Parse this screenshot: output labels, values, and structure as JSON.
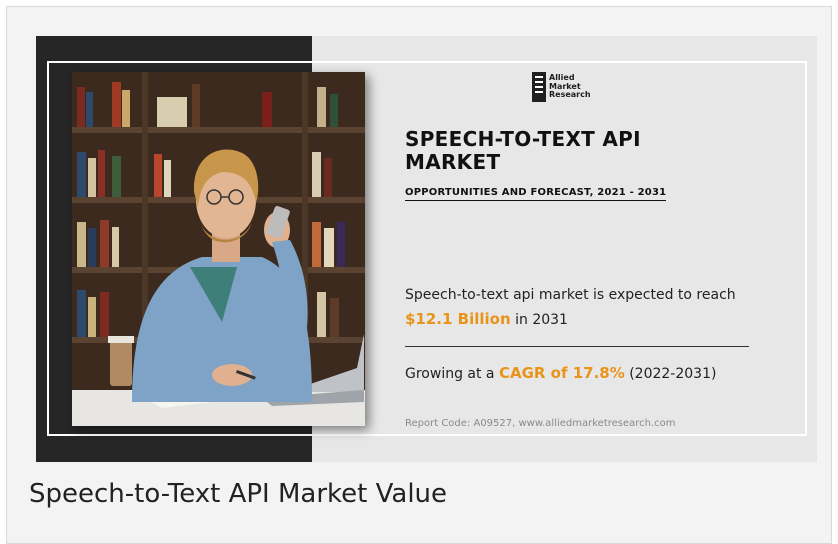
{
  "banner": {
    "logo_lines": [
      "Allied",
      "Market",
      "Research"
    ],
    "title_line1": "SPEECH-TO-TEXT API",
    "title_line2": "MARKET",
    "subtitle": "OPPORTUNITIES AND FORECAST, 2021 - 2031",
    "expect_text": "Speech-to-text api market is expected to reach",
    "expect_value": "$12.1 Billion",
    "expect_suffix": "in 2031",
    "growth_prefix": "Growing at a",
    "growth_value": "CAGR of 17.8%",
    "growth_suffix": "(2022-2031)",
    "report_code": "Report Code: A09527, www.alliedmarketresearch.com"
  },
  "caption": "Speech-to-Text API Market Value",
  "colors": {
    "accent": "#e8941a",
    "dark_panel": "#262626",
    "background": "#e7e7e7"
  }
}
